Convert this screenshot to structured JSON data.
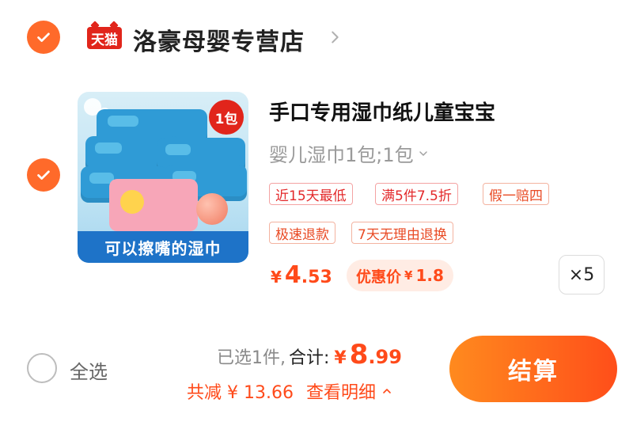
{
  "store": {
    "badge": "天猫",
    "name": "洛豪母婴专营店"
  },
  "item": {
    "thumb_badge": "1包",
    "thumb_caption": "可以擦嘴的湿巾",
    "title": "手口专用湿巾纸儿童宝宝",
    "sku": "婴儿湿巾1包;1包",
    "tags": [
      "近15天最低",
      "满5件7.5折",
      "假一赔四",
      "极速退款",
      "7天无理由退换"
    ],
    "price_currency": "¥",
    "price_int": "4",
    "price_dec": ".53",
    "promo_label": "优惠价",
    "promo_currency": "¥",
    "promo_value": "1.8",
    "qty": "×5"
  },
  "bottom": {
    "select_all": "全选",
    "selected": "已选1件,",
    "total_label": "合计:",
    "total_currency": "¥",
    "total_int": "8",
    "total_dec": ".99",
    "discount": "共减 ¥ 13.66",
    "detail": "查看明细",
    "checkout": "结算"
  },
  "colors": {
    "accent": "#ff4a1a",
    "check": "#ff6a2a",
    "tmall": "#e1251b"
  }
}
